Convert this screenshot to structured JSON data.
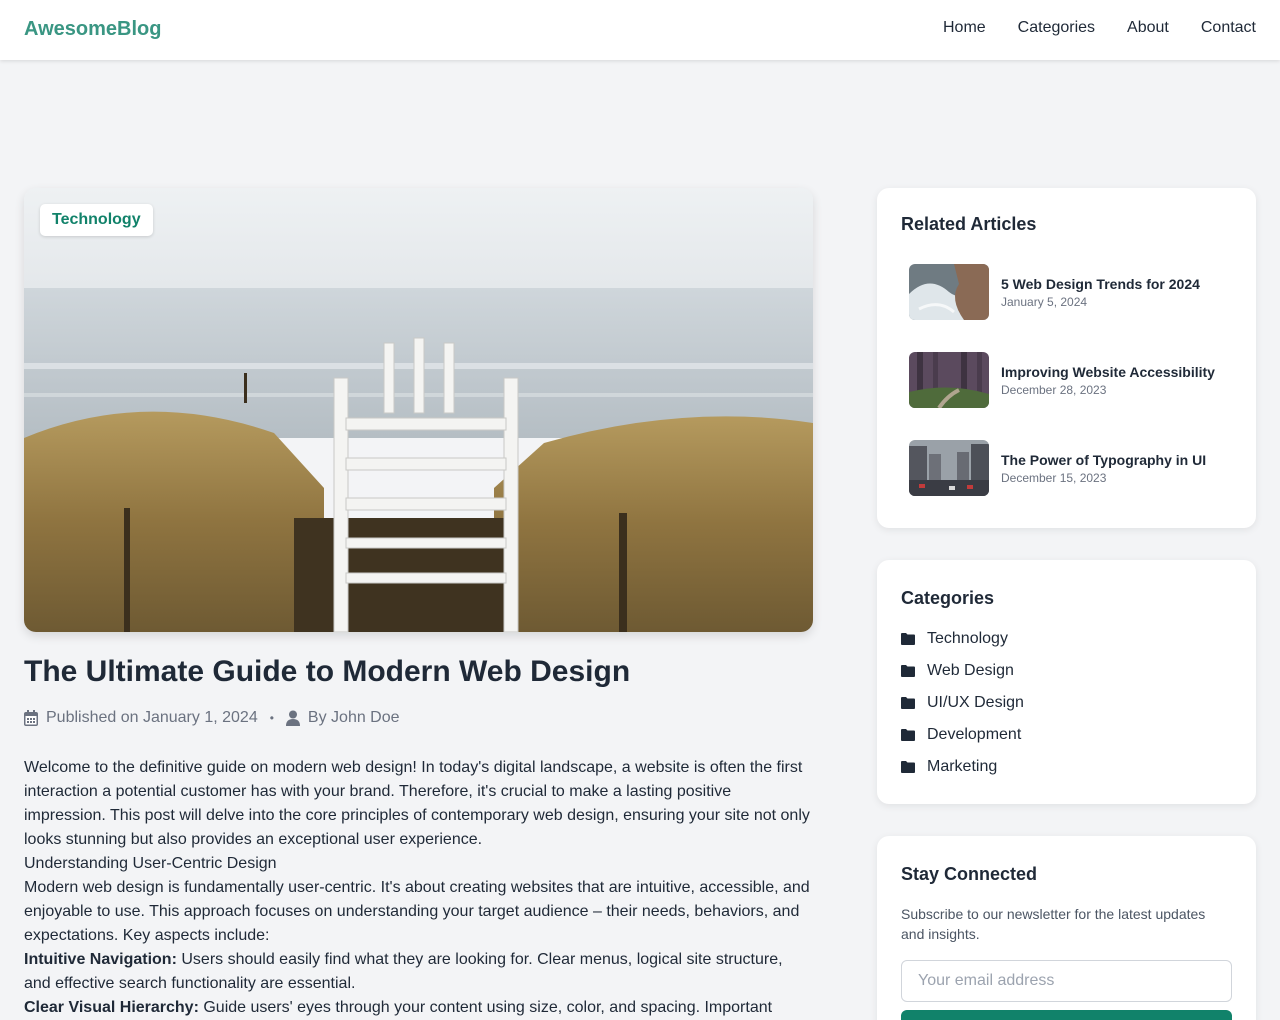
{
  "header": {
    "brand": "AwesomeBlog",
    "nav": [
      "Home",
      "Categories",
      "About",
      "Contact"
    ]
  },
  "post": {
    "category_tag": "Technology",
    "title": "The Ultimate Guide to Modern Web Design",
    "published": "Published on January 1, 2024",
    "author": "By John Doe",
    "intro": "Welcome to the definitive guide on modern web design! In today's digital landscape, a website is often the first interaction a potential customer has with your brand. Therefore, it's crucial to make a lasting positive impression. This post will delve into the core principles of contemporary web design, ensuring your site not only looks stunning but also provides an exceptional user experience.",
    "section_heading": "Understanding User-Centric Design",
    "section_body": "Modern web design is fundamentally user-centric. It's about creating websites that are intuitive, accessible, and enjoyable to use. This approach focuses on understanding your target audience – their needs, behaviors, and expectations. Key aspects include:",
    "points": [
      {
        "label": "Intuitive Navigation:",
        "text": "Users should easily find what they are looking for. Clear menus, logical site structure, and effective search functionality are essential."
      },
      {
        "label": "Clear Visual Hierarchy:",
        "text": "Guide users' eyes through your content using size, color, and spacing. Important"
      }
    ]
  },
  "sidebar": {
    "related": {
      "heading": "Related Articles",
      "items": [
        {
          "title": "5 Web Design Trends for 2024",
          "date": "January 5, 2024"
        },
        {
          "title": "Improving Website Accessibility",
          "date": "December 28, 2023"
        },
        {
          "title": "The Power of Typography in UI",
          "date": "December 15, 2023"
        }
      ]
    },
    "categories": {
      "heading": "Categories",
      "items": [
        "Technology",
        "Web Design",
        "UI/UX Design",
        "Development",
        "Marketing"
      ]
    },
    "newsletter": {
      "heading": "Stay Connected",
      "description": "Subscribe to our newsletter for the latest updates and insights.",
      "placeholder": "Your email address"
    }
  },
  "colors": {
    "brand": "#3a9683",
    "accent": "#11826a",
    "background": "#f3f4f6"
  }
}
